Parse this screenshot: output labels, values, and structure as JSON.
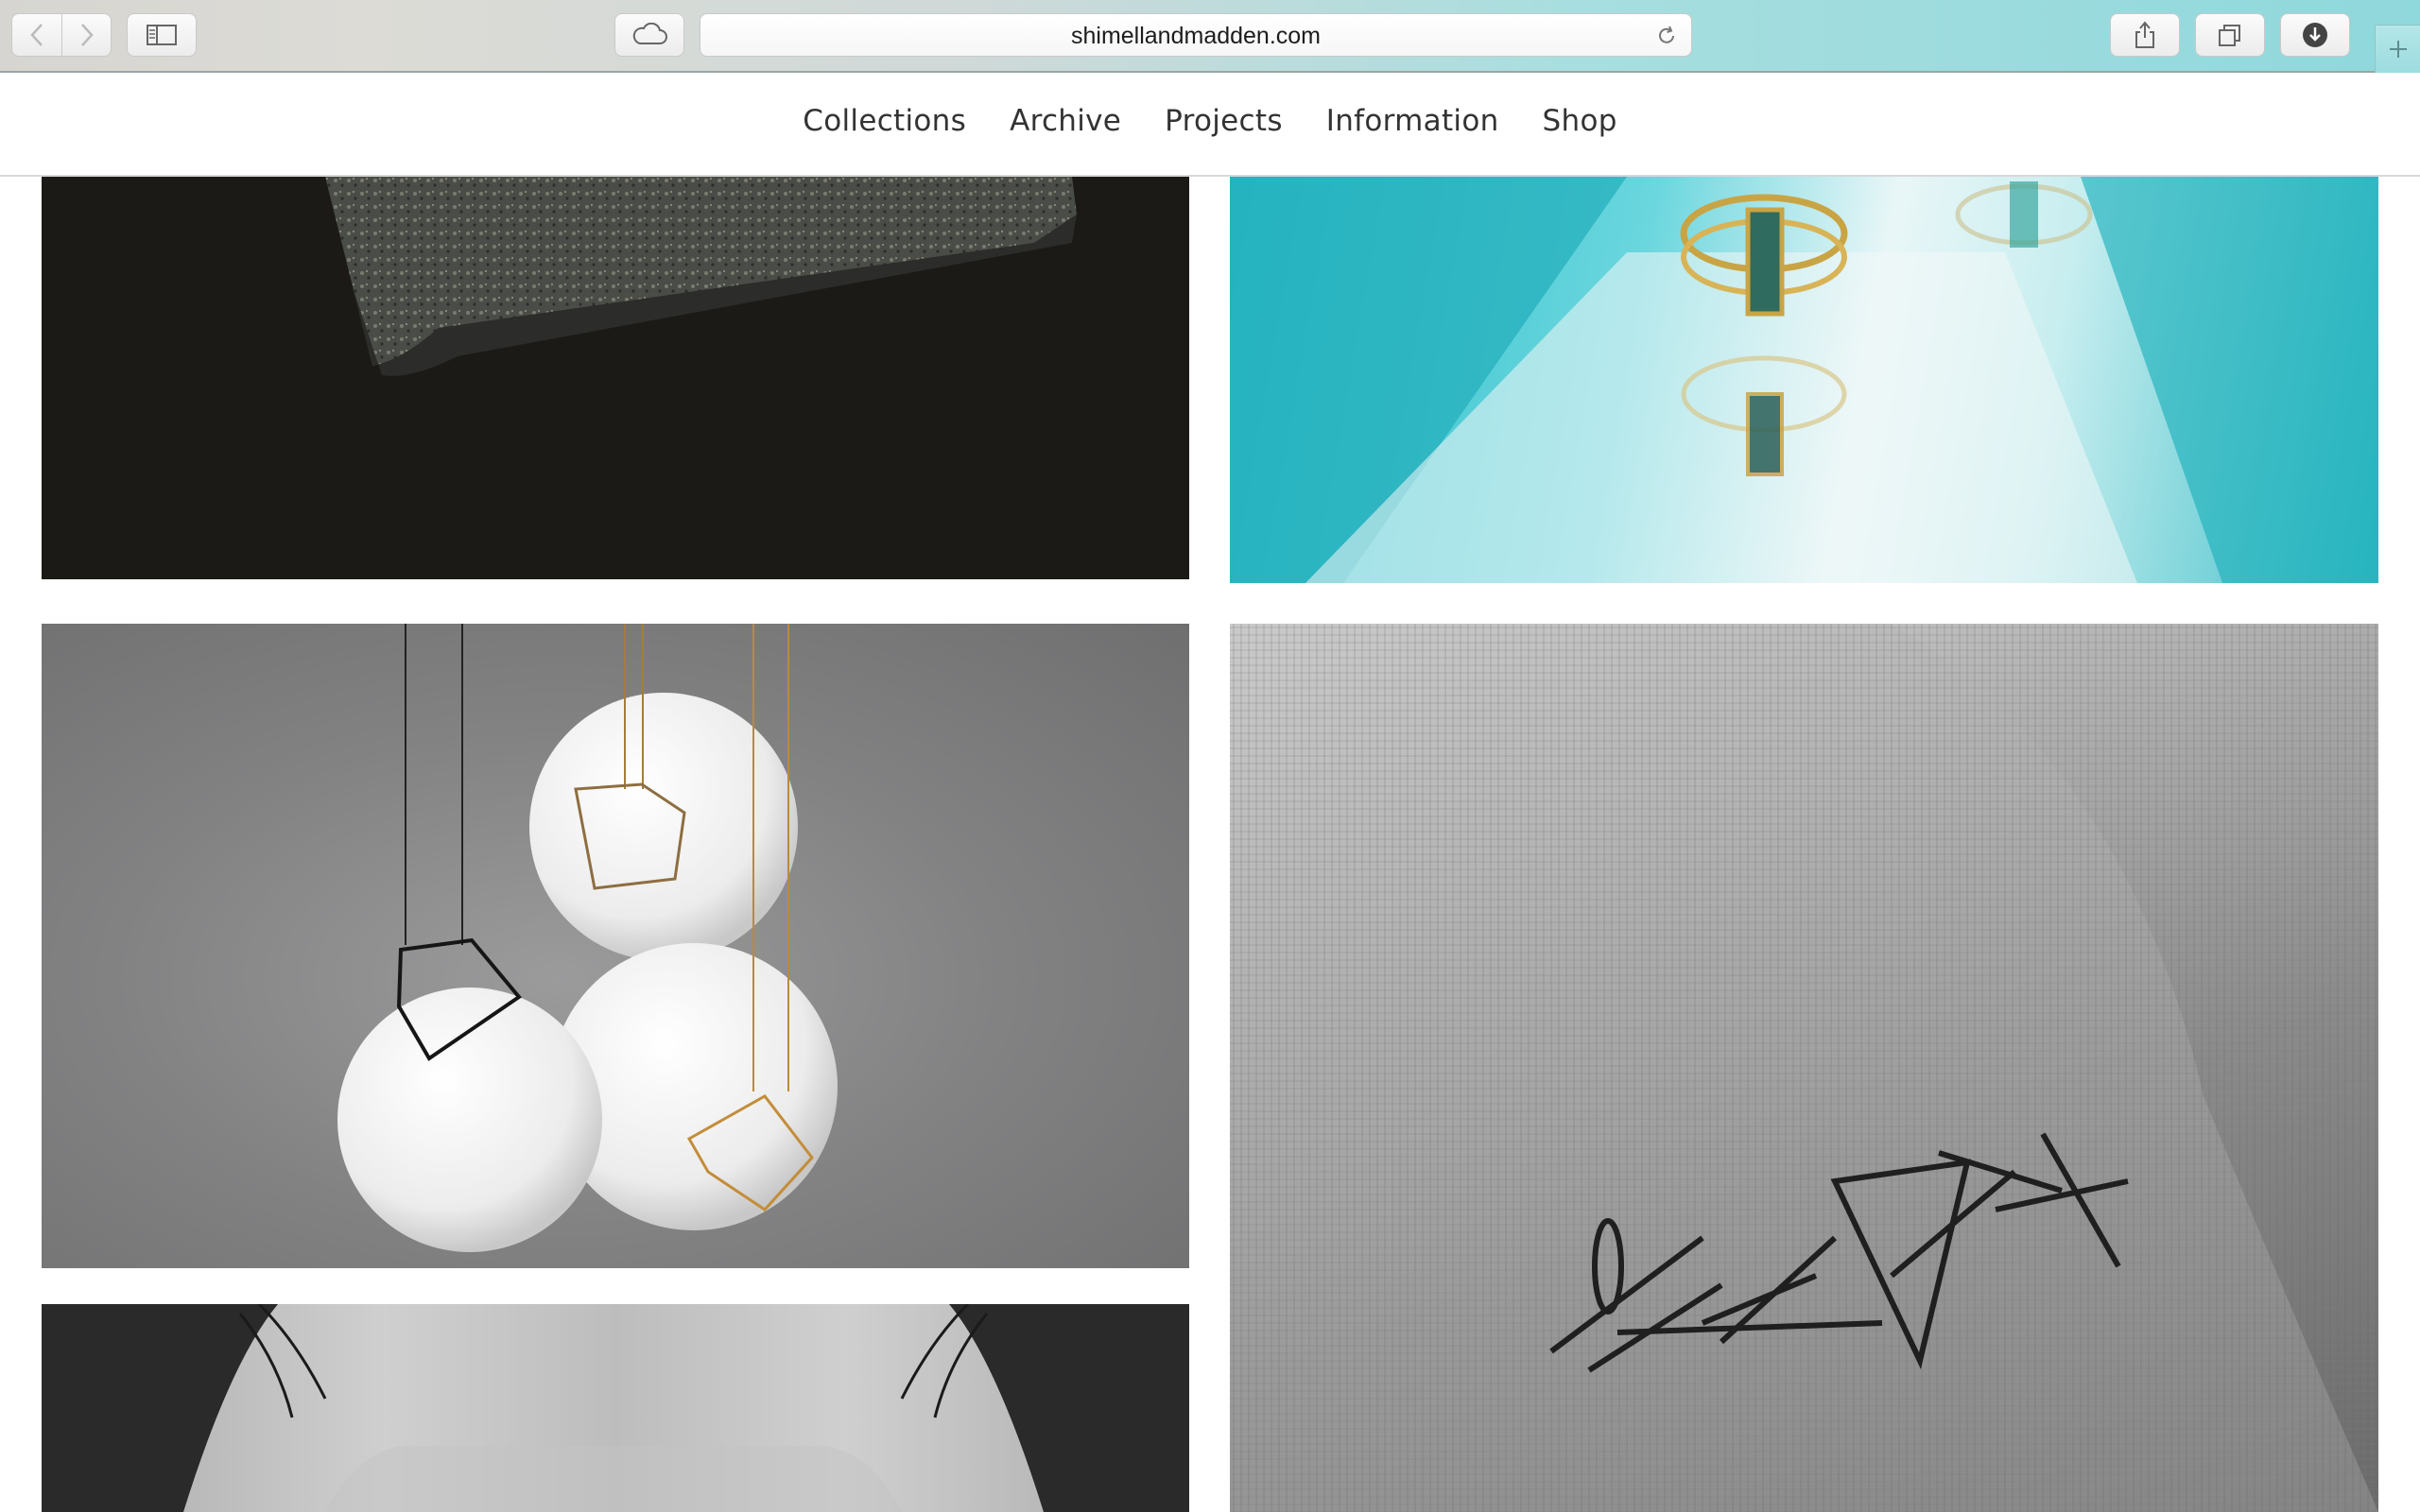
{
  "browser": {
    "url": "shimellandmadden.com",
    "icons": {
      "back": "chevron-left-icon",
      "forward": "chevron-right-icon",
      "sidebar": "sidebar-icon",
      "icloud": "cloud-icon",
      "reload": "reload-icon",
      "share": "share-icon",
      "tabs": "tabs-overview-icon",
      "downloads": "download-icon",
      "new_tab": "plus-icon"
    }
  },
  "nav": {
    "items": [
      {
        "label": "Collections"
      },
      {
        "label": "Archive"
      },
      {
        "label": "Projects"
      },
      {
        "label": "Information"
      },
      {
        "label": "Shop"
      }
    ]
  },
  "gallery": {
    "tiles": [
      {
        "subject": "stone-on-black-photo"
      },
      {
        "subject": "gold-ring-on-turquoise-glass-photo"
      },
      {
        "subject": "cube-pendants-on-white-spheres-photo"
      },
      {
        "subject": "black-needle-rings-on-fabric-photo"
      },
      {
        "subject": "black-and-white-hair-photo"
      }
    ]
  }
}
